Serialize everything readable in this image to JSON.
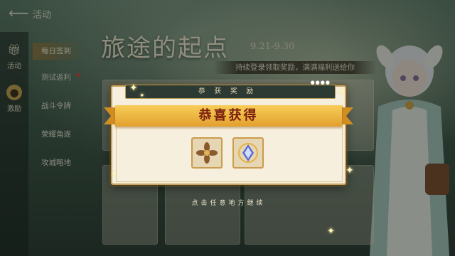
{
  "header": {
    "back_icon": "back-arrow-icon",
    "title": "活动"
  },
  "rail": [
    {
      "label": "活动",
      "icon": "gift-icon"
    },
    {
      "label": "激励",
      "icon": "medal-icon",
      "selected": true
    }
  ],
  "tabs": [
    {
      "label": "每日签到",
      "active": true
    },
    {
      "label": "测试返利",
      "dot": true
    },
    {
      "label": "战斗令牌"
    },
    {
      "label": "荣耀角逐"
    },
    {
      "label": "攻城略地"
    }
  ],
  "event": {
    "title": "旅途的起点",
    "date": "9.21-9.30",
    "subtitle": "持续登录领取奖励，满满福利送给你"
  },
  "modal": {
    "topbar": "恭获奖励",
    "title": "恭喜获得",
    "items": [
      {
        "name": "flower-material-icon"
      },
      {
        "name": "crystal-gem-icon"
      }
    ],
    "hint": "点击任意地方继续"
  },
  "colors": {
    "ribbon": "#f2c24c",
    "frame": "#caa35c",
    "title_text": "#7a1e0f"
  }
}
